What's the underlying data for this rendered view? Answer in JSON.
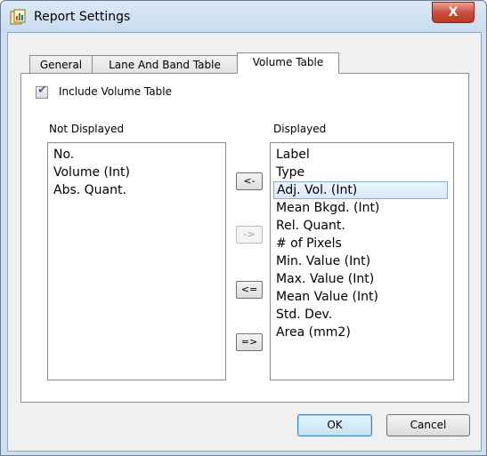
{
  "window": {
    "title": "Report Settings",
    "close_label": "X"
  },
  "tabs": [
    {
      "label": "General",
      "active": false
    },
    {
      "label": "Lane And Band Table",
      "active": false
    },
    {
      "label": "Volume Table",
      "active": true
    }
  ],
  "include_checkbox": {
    "label": "Include Volume Table",
    "checked": true
  },
  "not_displayed": {
    "label": "Not Displayed",
    "items": [
      "No.",
      "Volume (Int)",
      "Abs. Quant."
    ]
  },
  "displayed": {
    "label": "Displayed",
    "items": [
      "Label",
      "Type",
      "Adj. Vol. (Int)",
      "Mean Bkgd. (Int)",
      "Rel. Quant.",
      "# of Pixels",
      "Min. Value (Int)",
      "Max. Value (Int)",
      "Mean Value (Int)",
      "Std. Dev.",
      "Area (mm2)"
    ],
    "selected_item": "Adj. Vol. (Int)"
  },
  "move_buttons": {
    "move_left": "<-",
    "move_right": "->",
    "move_all_left": "<=",
    "move_all_right": "=>"
  },
  "footer": {
    "ok_label": "OK",
    "cancel_label": "Cancel"
  }
}
